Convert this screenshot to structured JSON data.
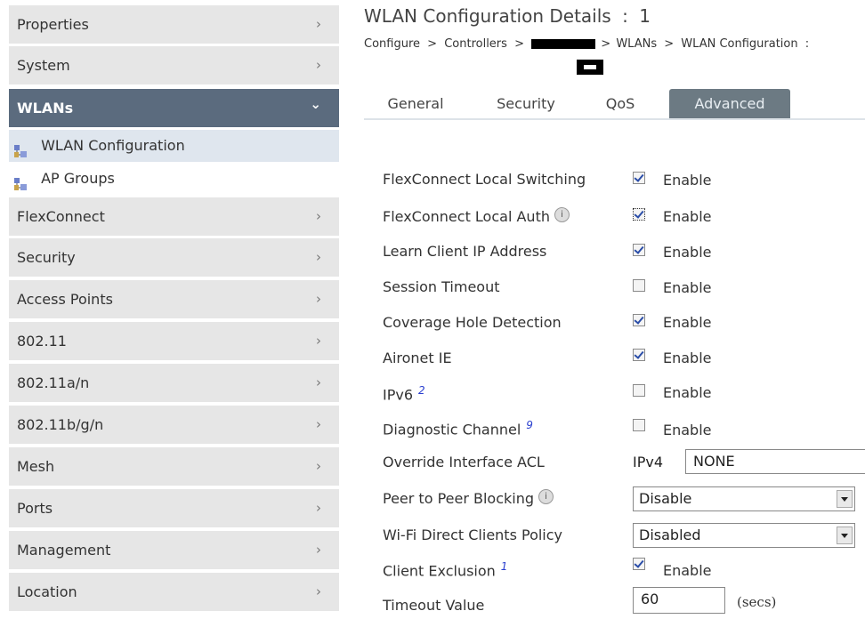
{
  "sidebar": {
    "items": [
      {
        "label": "Properties"
      },
      {
        "label": "System"
      },
      {
        "label": "WLANs"
      },
      {
        "label": "FlexConnect"
      },
      {
        "label": "Security"
      },
      {
        "label": "Access Points"
      },
      {
        "label": "802.11"
      },
      {
        "label": "802.11a/n"
      },
      {
        "label": "802.11b/g/n"
      },
      {
        "label": "Mesh"
      },
      {
        "label": "Ports"
      },
      {
        "label": "Management"
      },
      {
        "label": "Location"
      }
    ],
    "subitems": [
      {
        "label": "WLAN Configuration"
      },
      {
        "label": "AP Groups"
      }
    ]
  },
  "header": {
    "title": "WLAN Configuration Details",
    "separator": ":",
    "id": "1"
  },
  "breadcrumb": {
    "configure": "Configure",
    "controllers": "Controllers",
    "wlans": "WLANs",
    "wlan_config": "WLAN Configuration",
    "sep": ">",
    "trailing": ":"
  },
  "tabs": [
    {
      "label": "General"
    },
    {
      "label": "Security"
    },
    {
      "label": "QoS"
    },
    {
      "label": "Advanced"
    }
  ],
  "settings": {
    "enable_label": "Enable",
    "flexconnect_local_switching": {
      "label": "FlexConnect Local Switching",
      "checked": true
    },
    "flexconnect_local_auth": {
      "label": "FlexConnect Local Auth",
      "checked": true
    },
    "learn_client_ip": {
      "label": "Learn Client IP Address",
      "checked": true
    },
    "session_timeout": {
      "label": "Session Timeout",
      "checked": false
    },
    "coverage_hole_detection": {
      "label": "Coverage Hole Detection",
      "checked": true
    },
    "aironet_ie": {
      "label": "Aironet IE",
      "checked": true
    },
    "ipv6": {
      "label": "IPv6",
      "ref": "2",
      "checked": false
    },
    "diagnostic_channel": {
      "label": "Diagnostic Channel",
      "ref": "9",
      "checked": false
    },
    "override_acl": {
      "label": "Override Interface ACL",
      "ip_label": "IPv4",
      "value": "NONE"
    },
    "peer_blocking": {
      "label": "Peer to Peer Blocking",
      "value": "Disable"
    },
    "wifi_direct": {
      "label": "Wi-Fi Direct Clients Policy",
      "value": "Disabled"
    },
    "client_exclusion": {
      "label": "Client Exclusion",
      "ref": "1",
      "checked": true
    },
    "timeout_value": {
      "label": "Timeout Value",
      "value": "60",
      "unit": "(secs)"
    }
  },
  "icons": {
    "info": "i",
    "chevron_right": "›",
    "chevron_down": "⌄"
  },
  "colors": {
    "active_nav": "#5b6b7e",
    "nav_bg": "#e6e6e6",
    "active_tab": "#6c7a83",
    "selected_sub": "#dfe6ee"
  }
}
